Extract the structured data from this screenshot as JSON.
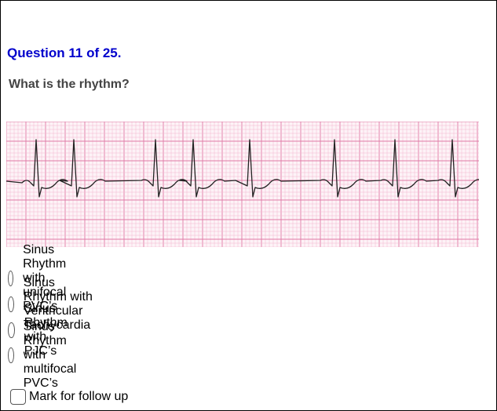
{
  "question": {
    "number_text": "Question 11 of 25.",
    "prompt": "What is the rhythm?"
  },
  "options": [
    {
      "label": "Sinus Rhythm with unifocal PVC’s",
      "selected": false
    },
    {
      "label": "Sinus Rhythm with Ventricular Tachycardia",
      "selected": false
    },
    {
      "label": "Sinus Rhythm with PJC’s",
      "selected": false
    },
    {
      "label": "Sinus Rhythm with multifocal PVC’s",
      "selected": false
    }
  ],
  "follow_up": {
    "label": "Mark for follow up",
    "checked": false
  },
  "colors": {
    "question_number": "#0000cc",
    "question_text": "#444444",
    "ecg_grid_minor": "#f4b6cf",
    "ecg_grid_major": "#e07aa5",
    "ecg_trace": "#222222"
  },
  "ecg_strip": {
    "image": "ecg-rhythm-strip"
  }
}
